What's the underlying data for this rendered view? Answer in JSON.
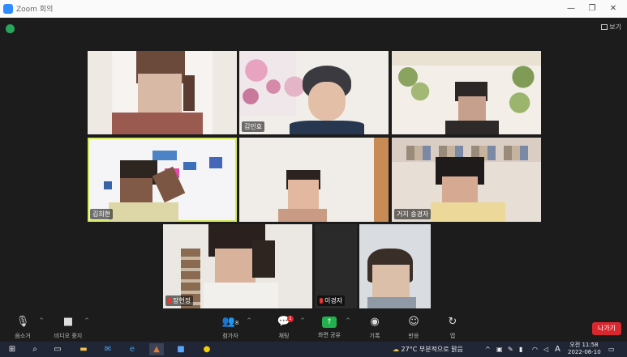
{
  "window": {
    "title": "Zoom 회의",
    "controls": [
      "—",
      "❐",
      "✕"
    ]
  },
  "meeting": {
    "view_label": "보기"
  },
  "participants": [
    {
      "name": "",
      "muted": false
    },
    {
      "name": "김민효",
      "muted": false
    },
    {
      "name": "",
      "muted": false
    },
    {
      "name": "김희현",
      "muted": false
    },
    {
      "name": "",
      "muted": false
    },
    {
      "name": "거지 송경자",
      "muted": false
    },
    {
      "name": "장현정",
      "muted": true
    },
    {
      "name": "이경자",
      "muted": true
    },
    {
      "name": "",
      "muted": false
    }
  ],
  "toolbar": {
    "mute_label": "음소거",
    "video_label": "비디오 중지",
    "participants_label": "참가자",
    "participants_count": "8",
    "chat_label": "채팅",
    "chat_badge": "1",
    "share_label": "화면 공유",
    "record_label": "기록",
    "reactions_label": "반응",
    "apps_label": "앱",
    "leave_label": "나가기"
  },
  "taskbar": {
    "weather": "27°C 부분적으로 맑음",
    "ime": "A",
    "time": "오전 11:58",
    "date": "2022-06-10"
  },
  "colors": {
    "leave": "#d9272e",
    "share": "#23b14d",
    "active_speaker": "#d6e85c"
  }
}
